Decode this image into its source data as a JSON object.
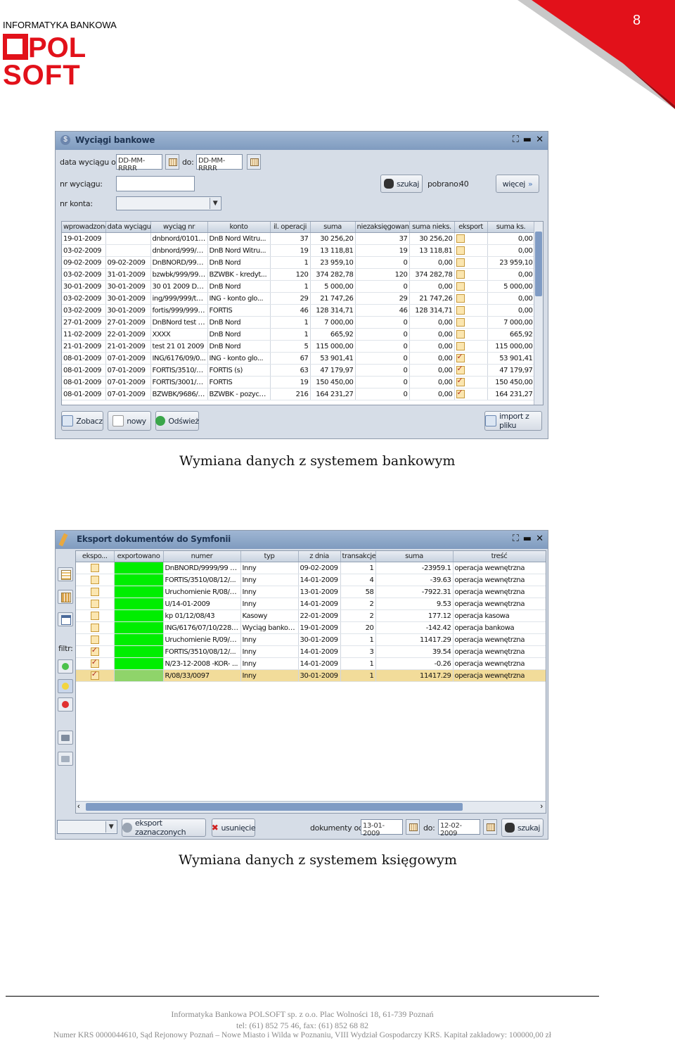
{
  "header": {
    "company_small": "INFORMATYKA BANKOWA",
    "logo_line1": "POL",
    "logo_line2": "SOFT",
    "logo_letter_o": "O",
    "page_number": "8",
    "brand_red": "#e2111a"
  },
  "window1": {
    "title": "Wyciągi bankowe",
    "label_from": "data wyciągu od:",
    "date_from_value": "DD-MM-RRRR",
    "label_to": "do:",
    "date_to_value": "DD-MM-RRRR",
    "label_statement_no": "nr wyciągu:",
    "label_account_no": "nr konta:",
    "search_label": "szukaj",
    "fetched_label": "pobrano:",
    "fetched_count": "40",
    "more_label": "więcej",
    "columns": [
      "wprowadzono",
      "data wyciągu",
      "wyciąg nr",
      "konto",
      "il. operacji",
      "suma",
      "niezaksięgowane",
      "suma nieks.",
      "eksport",
      "suma ks."
    ],
    "rows": [
      [
        "19-01-2009",
        "",
        "dnbnord/0101/...",
        "DnB Nord Witru...",
        "37",
        "30 256,20",
        "37",
        "30 256,20",
        "off",
        "0,00"
      ],
      [
        "03-02-2009",
        "",
        "dnbnord/999/9...",
        "DnB Nord Witru...",
        "19",
        "13 118,81",
        "19",
        "13 118,81",
        "off",
        "0,00"
      ],
      [
        "09-02-2009",
        "09-02-2009",
        "DnBNORD/9999...",
        "DnB Nord",
        "1",
        "23 959,10",
        "0",
        "0,00",
        "off",
        "23 959,10"
      ],
      [
        "03-02-2009",
        "31-01-2009",
        "bzwbk/999/99/t...",
        "BZWBK - kredyt...",
        "120",
        "374 282,78",
        "120",
        "374 282,78",
        "off",
        "0,00"
      ],
      [
        "30-01-2009",
        "30-01-2009",
        "30 01 2009 DnB...",
        "DnB Nord",
        "1",
        "5 000,00",
        "0",
        "0,00",
        "off",
        "5 000,00"
      ],
      [
        "03-02-2009",
        "30-01-2009",
        "ing/999/999/test",
        "ING - konto glo...",
        "29",
        "21 747,26",
        "29",
        "21 747,26",
        "off",
        "0,00"
      ],
      [
        "03-02-2009",
        "30-01-2009",
        "fortis/999/999/t...",
        "FORTIS",
        "46",
        "128 314,71",
        "46",
        "128 314,71",
        "off",
        "0,00"
      ],
      [
        "27-01-2009",
        "27-01-2009",
        "DnBNord test 2...",
        "DnB Nord",
        "1",
        "7 000,00",
        "0",
        "0,00",
        "off",
        "7 000,00"
      ],
      [
        "11-02-2009",
        "22-01-2009",
        "XXXX",
        "DnB Nord",
        "1",
        "665,92",
        "0",
        "0,00",
        "off",
        "665,92"
      ],
      [
        "21-01-2009",
        "21-01-2009",
        "test 21 01 2009",
        "DnB Nord",
        "5",
        "115 000,00",
        "0",
        "0,00",
        "off",
        "115 000,00"
      ],
      [
        "08-01-2009",
        "07-01-2009",
        "ING/6176/09/0...",
        "ING - konto glo...",
        "67",
        "53 901,41",
        "0",
        "0,00",
        "on",
        "53 901,41"
      ],
      [
        "08-01-2009",
        "07-01-2009",
        "FORTIS/3510/0...",
        "FORTIS (s)",
        "63",
        "47 179,97",
        "0",
        "0,00",
        "on",
        "47 179,97"
      ],
      [
        "08-01-2009",
        "07-01-2009",
        "FORTIS/3001/0...",
        "FORTIS",
        "19",
        "150 450,00",
        "0",
        "0,00",
        "on",
        "150 450,00"
      ],
      [
        "08-01-2009",
        "07-01-2009",
        "BZWBK/9686/0...",
        "BZWBK - pozycz...",
        "216",
        "164 231,27",
        "0",
        "0,00",
        "on",
        "164 231,27"
      ]
    ],
    "btn_view": "Zobacz",
    "btn_new": "nowy",
    "btn_refresh": "Odśwież",
    "btn_import": "import z pliku"
  },
  "caption1": "Wymiana danych z systemem bankowym",
  "window2": {
    "title": "Eksport dokumentów do Symfonii",
    "filter_label": "filtr:",
    "columns": [
      "ekspo...",
      "exportowano",
      "numer",
      "typ",
      "z dnia",
      "transakcje",
      "suma",
      "treść"
    ],
    "rows": [
      [
        "off",
        "",
        "DnBNORD/9999/99 -K...",
        "Inny",
        "09-02-2009",
        "1",
        "-23959.1",
        "operacja wewnętrzna"
      ],
      [
        "off",
        "",
        "FORTIS/3510/08/12/...",
        "Inny",
        "14-01-2009",
        "4",
        "-39.63",
        "operacja wewnętrzna"
      ],
      [
        "off",
        "",
        "Uruchomienie R/08/2...",
        "Inny",
        "13-01-2009",
        "58",
        "-7922.31",
        "operacja wewnętrzna"
      ],
      [
        "off",
        "",
        "U/14-01-2009",
        "Inny",
        "14-01-2009",
        "2",
        "9.53",
        "operacja wewnętrzna"
      ],
      [
        "off",
        "",
        "kp 01/12/08/43",
        "Kasowy",
        "22-01-2009",
        "2",
        "177.12",
        "operacja kasowa"
      ],
      [
        "off",
        "",
        "ING/6176/07/10/228 ...",
        "Wyciąg bankowy",
        "19-01-2009",
        "20",
        "-142.42",
        "operacja bankowa"
      ],
      [
        "off",
        "",
        "Uruchomienie R/09/9...",
        "Inny",
        "30-01-2009",
        "1",
        "11417.29",
        "operacja wewnętrzna"
      ],
      [
        "on",
        "",
        "FORTIS/3510/08/12/...",
        "Inny",
        "14-01-2009",
        "3",
        "39.54",
        "operacja wewnętrzna"
      ],
      [
        "on",
        "",
        "N/23-12-2008 -KOR- ...",
        "Inny",
        "14-01-2009",
        "1",
        "-0.26",
        "operacja wewnętrzna"
      ],
      [
        "on",
        "",
        "R/08/33/0097",
        "Inny",
        "30-01-2009",
        "1",
        "11417.29",
        "operacja wewnętrzna"
      ]
    ],
    "btn_export_selected": "eksport zaznaczonych",
    "btn_remove": "usunięcie",
    "docs_from_label": "dokumenty od:",
    "docs_from_value": "13-01-2009",
    "docs_to_label": "do:",
    "docs_to_value": "12-02-2009",
    "btn_search": "szukaj",
    "exported_color": "#00ee00"
  },
  "caption2": "Wymiana danych z systemem księgowym",
  "footer": {
    "line1": "Informatyka Bankowa POLSOFT sp. z o.o. Plac Wolności 18, 61-739 Poznań",
    "line2": "tel: (61) 852 75 46, fax: (61) 852 68 82",
    "line3": "Numer KRS 0000044610, Sąd Rejonowy Poznań – Nowe Miasto i Wilda w Poznaniu, VIII Wydział Gospodarczy KRS. Kapitał zakładowy: 100000,00 zł"
  }
}
